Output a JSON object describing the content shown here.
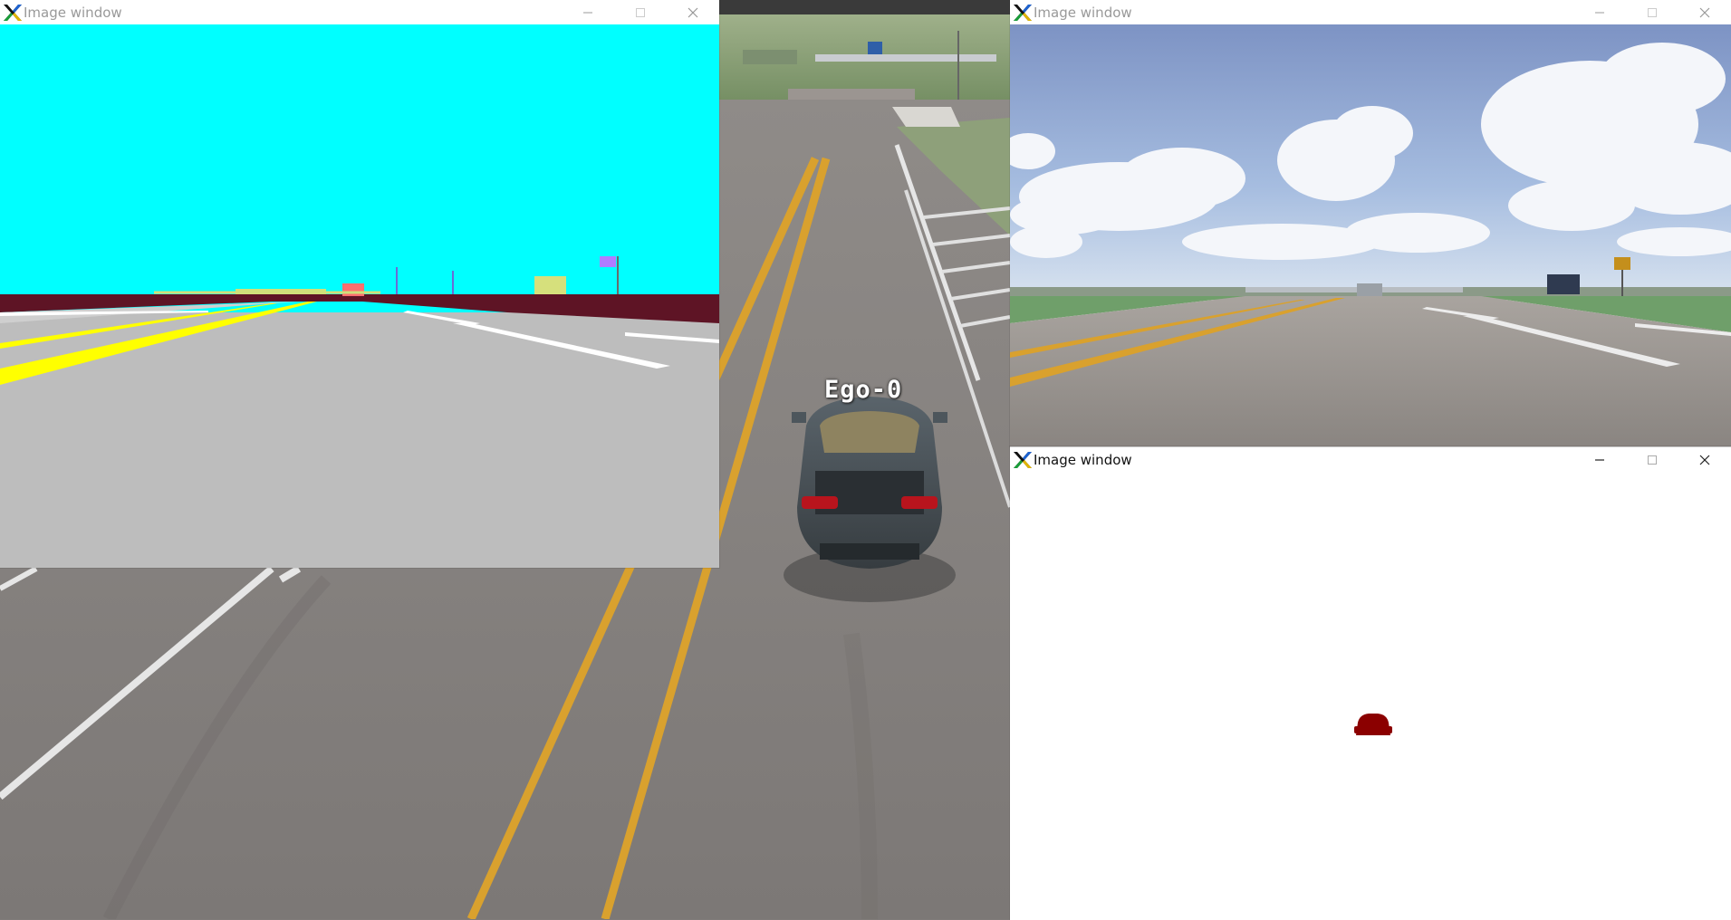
{
  "simulator": {
    "ego_label": "Ego-0"
  },
  "windows": {
    "segmentation": {
      "title": "Image window",
      "icon": "x-app-icon",
      "focused": false
    },
    "camera_rgb": {
      "title": "Image window",
      "icon": "x-app-icon",
      "focused": false
    },
    "mask": {
      "title": "Image window",
      "icon": "x-app-icon",
      "focused": true
    }
  },
  "colors": {
    "seg_sky": "#00ffff",
    "seg_road": "#bdbdbd",
    "seg_sidewalk": "#5e1425",
    "seg_lane_yellow": "#ffff00",
    "seg_vehicle": "#ff6f6f",
    "mask_vehicle": "#8b0000",
    "lane_orange": "#d9a12e"
  },
  "window_controls": [
    "minimize-icon",
    "maximize-icon",
    "close-icon"
  ]
}
